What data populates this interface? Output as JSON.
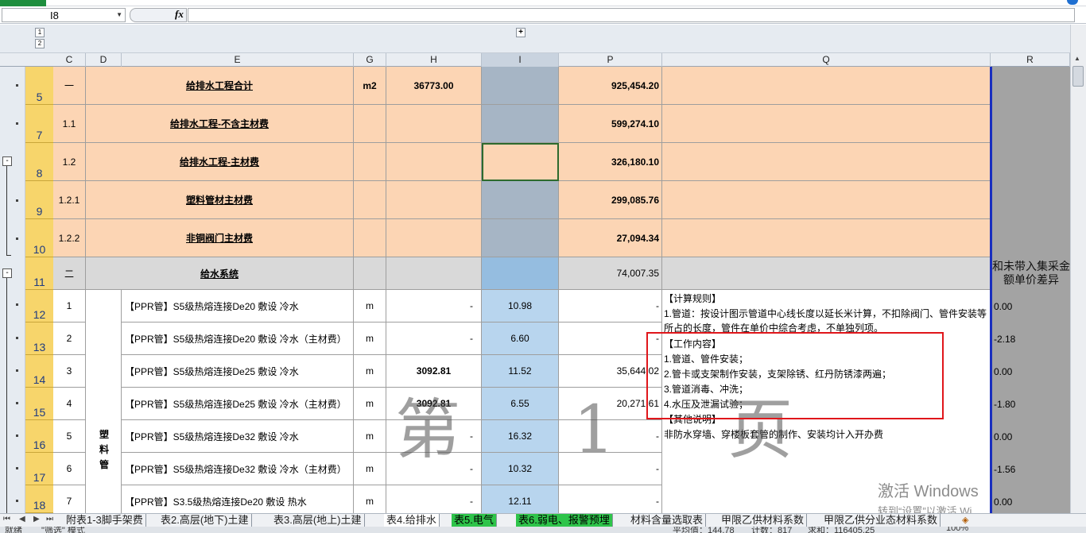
{
  "name_box": {
    "value": "I8"
  },
  "formula_bar": {
    "fx": "fx",
    "value": ""
  },
  "outline": {
    "col_levels": [
      "1",
      "2"
    ],
    "row_levels": [
      "1",
      "2"
    ],
    "expand": "+",
    "collapse": "-"
  },
  "columns": [
    "C",
    "D",
    "E",
    "G",
    "H",
    "I",
    "P",
    "Q",
    "R"
  ],
  "rows": [
    {
      "num": "5",
      "c": "一",
      "d": "",
      "e": "给排水工程合计",
      "g": "m2",
      "h": "36773.00",
      "i": "",
      "p": "925,454.20",
      "r": ""
    },
    {
      "num": "7",
      "c": "1.1",
      "d": "",
      "e": "给排水工程-不含主材费",
      "g": "",
      "h": "",
      "i": "",
      "p": "599,274.10",
      "r": ""
    },
    {
      "num": "8",
      "c": "1.2",
      "d": "",
      "e": "给排水工程-主材费",
      "g": "",
      "h": "",
      "i": "",
      "p": "326,180.10",
      "r": ""
    },
    {
      "num": "9",
      "c": "1.2.1",
      "d": "",
      "e": "塑料管材主材费",
      "g": "",
      "h": "",
      "i": "",
      "p": "299,085.76",
      "r": ""
    },
    {
      "num": "10",
      "c": "1.2.2",
      "d": "",
      "e": "非铜阀门主材费",
      "g": "",
      "h": "",
      "i": "",
      "p": "27,094.34",
      "r": ""
    },
    {
      "num": "11",
      "c": "二",
      "d": "",
      "e": "给水系统",
      "g": "",
      "h": "",
      "i": "",
      "p": "74,007.35",
      "r": "和未带入集采金额单价差异"
    },
    {
      "num": "12",
      "c": "1",
      "d": "",
      "e": "【PPR管】S5级热熔连接De20 敷设 冷水",
      "g": "m",
      "h": "-",
      "i": "10.98",
      "p": "-",
      "r": "0.00"
    },
    {
      "num": "13",
      "c": "2",
      "d": "",
      "e": "【PPR管】S5级热熔连接De20 敷设 冷水（主材费）",
      "g": "m",
      "h": "-",
      "i": "6.60",
      "p": "-",
      "r": "-2.18"
    },
    {
      "num": "14",
      "c": "3",
      "d": "",
      "e": "【PPR管】S5级热熔连接De25 敷设 冷水",
      "g": "m",
      "h": "3092.81",
      "i": "11.52",
      "p": "35,644.02",
      "r": "0.00"
    },
    {
      "num": "15",
      "c": "4",
      "d": "",
      "e": "【PPR管】S5级热熔连接De25 敷设 冷水（主材费）",
      "g": "m",
      "h": "3092.81",
      "i": "6.55",
      "p": "20,271.61",
      "r": "-1.80"
    },
    {
      "num": "16",
      "c": "5",
      "d": "",
      "e": "【PPR管】S5级热熔连接De32 敷设 冷水",
      "g": "m",
      "h": "-",
      "i": "16.32",
      "p": "-",
      "r": "0.00"
    },
    {
      "num": "17",
      "c": "6",
      "d": "",
      "e": "【PPR管】S5级热熔连接De32 敷设 冷水（主材费）",
      "g": "m",
      "h": "-",
      "i": "10.32",
      "p": "-",
      "r": "-1.56"
    },
    {
      "num": "18",
      "c": "7",
      "d": "",
      "e": "【PPR管】S3.5级热熔连接De20 敷设 热水",
      "g": "m",
      "h": "-",
      "i": "12.11",
      "p": "-",
      "r": "0.00"
    }
  ],
  "merged_d_label": "塑料管",
  "notes": [
    "【计算规则】",
    "1.管道：按设计图示管道中心线长度以延长米计算，不扣除阀门、管件安装等",
    "所占的长度，管件在单价中综合考虑，不单独列项。",
    "【工作内容】",
    "1.管道、管件安装；",
    "2.管卡或支架制作安装，支架除锈、红丹防锈漆两遍；",
    "3.管道消毒、冲洗；",
    "4.水压及泄漏试验；",
    "【其他说明】",
    "非防水穿墙、穿楼板套管的制作、安装均计入开办费"
  ],
  "watermark": "第 1 页",
  "activation": {
    "line1": "激活 Windows",
    "line2": "转到“设置”以激活 Wi"
  },
  "tab_nav": [
    "⏮",
    "◀",
    "▶",
    "⏭"
  ],
  "tabs": [
    {
      "label": "附表1-3脚手架费",
      "state": "normal"
    },
    {
      "label": "表2.高层(地下)土建",
      "state": "normal"
    },
    {
      "label": "表3.高层(地上)土建",
      "state": "normal"
    },
    {
      "label": "表4.给排水",
      "state": "active"
    },
    {
      "label": "表5.电气",
      "state": "green"
    },
    {
      "label": "表6.弱电、报警预埋",
      "state": "green"
    },
    {
      "label": "材料含量选取表",
      "state": "normal"
    },
    {
      "label": "甲限乙供材料系数",
      "state": "normal"
    },
    {
      "label": "甲限乙供分业态材料系数",
      "state": "normal"
    }
  ],
  "status": {
    "mode": "就绪",
    "filter": "\"筛选\" 模式",
    "average": "平均值：144.78",
    "count": "计数：817",
    "sum": "求和：116405.25",
    "zoom": "100%"
  },
  "colors": {
    "peach": "#fcd5b4",
    "grey_row": "#d9d9d9",
    "selected_column": "#b8d5ee",
    "row_header": "#f7d56b",
    "red_box": "#e0161b"
  }
}
